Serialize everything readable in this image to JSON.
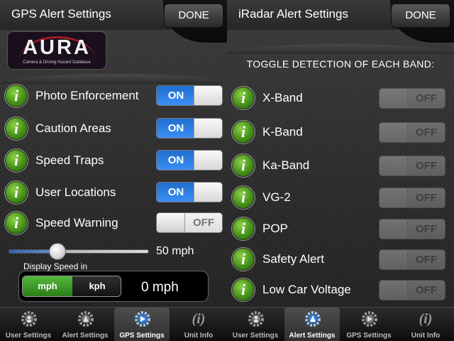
{
  "left_screen": {
    "title": "GPS Alert Settings",
    "done_label": "DONE",
    "logo": {
      "text": "AURA",
      "subtitle": "Camera & Driving Hazard Database"
    },
    "rows": [
      {
        "label": "Photo Enforcement",
        "toggle": "ON",
        "on": true
      },
      {
        "label": "Caution Areas",
        "toggle": "ON",
        "on": true
      },
      {
        "label": "Speed Traps",
        "toggle": "ON",
        "on": true
      },
      {
        "label": "User Locations",
        "toggle": "ON",
        "on": true
      },
      {
        "label": "Speed Warning",
        "toggle": "OFF",
        "on": false
      }
    ],
    "speed_slider": {
      "value_label": "50 mph",
      "fraction": 0.35
    },
    "display_speed": {
      "caption": "Display Speed in",
      "options": [
        "mph",
        "kph"
      ],
      "selected": "mph",
      "readout": "0 mph"
    }
  },
  "right_screen": {
    "title": "iRadar Alert Settings",
    "done_label": "DONE",
    "section_header": "TOGGLE DETECTION OF EACH BAND:",
    "rows": [
      {
        "label": "X-Band",
        "toggle": "OFF",
        "on": false
      },
      {
        "label": "K-Band",
        "toggle": "OFF",
        "on": false
      },
      {
        "label": "Ka-Band",
        "toggle": "OFF",
        "on": false
      },
      {
        "label": "VG-2",
        "toggle": "OFF",
        "on": false
      },
      {
        "label": "POP",
        "toggle": "OFF",
        "on": false
      },
      {
        "label": "Safety Alert",
        "toggle": "OFF",
        "on": false
      },
      {
        "label": "Low Car Voltage",
        "toggle": "OFF",
        "on": false
      }
    ]
  },
  "tabbar": {
    "tabs": [
      {
        "label": "User Settings",
        "icon": "gear-person-icon",
        "active": false
      },
      {
        "label": "Alert Settings",
        "icon": "gear-alert-icon",
        "active": false
      },
      {
        "label": "GPS Settings",
        "icon": "gear-gps-icon",
        "active": true
      },
      {
        "label": "Unit Info",
        "icon": "info-icon",
        "active": false
      },
      {
        "label": "User Settings",
        "icon": "gear-person-icon",
        "active": false
      },
      {
        "label": "Alert Settings",
        "icon": "gear-alert-icon",
        "active": true
      },
      {
        "label": "GPS Settings",
        "icon": "gear-gps-icon",
        "active": false
      },
      {
        "label": "Unit Info",
        "icon": "info-icon",
        "active": false
      }
    ]
  },
  "colors": {
    "toggle_on": "#2f80e4",
    "info_icon_green": "#4c9a1d",
    "segment_selected": "#3f9a28",
    "slider_fill": "#2d64b6"
  },
  "info_glyph": "i",
  "info_tab_glyph": "(i)"
}
